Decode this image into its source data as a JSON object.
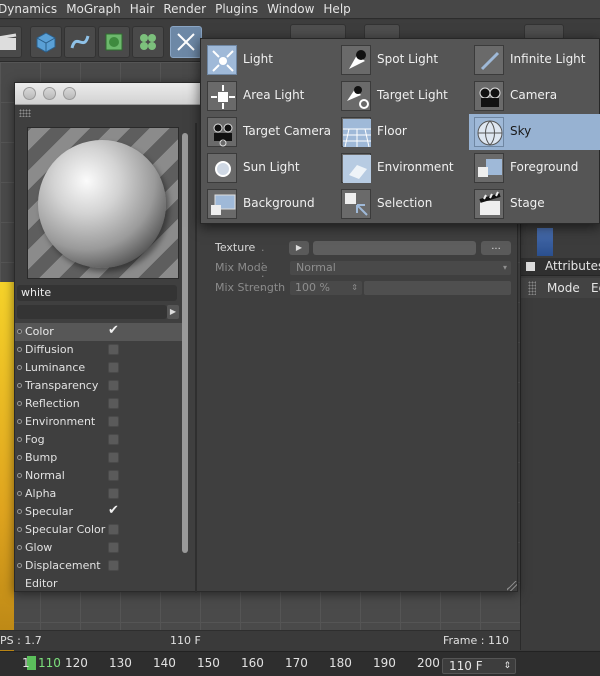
{
  "menubar": {
    "items": [
      "Dynamics",
      "MoGraph",
      "Hair",
      "Render",
      "Plugins",
      "Window",
      "Help"
    ]
  },
  "popup": {
    "items": [
      {
        "label": "Light",
        "icon": "light-icon"
      },
      {
        "label": "Area Light",
        "icon": "area-light-icon"
      },
      {
        "label": "Target Camera",
        "icon": "target-camera-icon"
      },
      {
        "label": "Sun Light",
        "icon": "sun-light-icon"
      },
      {
        "label": "Background",
        "icon": "background-icon"
      },
      {
        "label": "Spot Light",
        "icon": "spot-light-icon"
      },
      {
        "label": "Target Light",
        "icon": "target-light-icon"
      },
      {
        "label": "Floor",
        "icon": "floor-icon"
      },
      {
        "label": "Environment",
        "icon": "environment-icon"
      },
      {
        "label": "Selection",
        "icon": "selection-icon"
      },
      {
        "label": "Infinite Light",
        "icon": "infinite-light-icon"
      },
      {
        "label": "Camera",
        "icon": "camera-icon"
      },
      {
        "label": "Sky",
        "icon": "sky-icon"
      },
      {
        "label": "Foreground",
        "icon": "foreground-icon"
      },
      {
        "label": "Stage",
        "icon": "stage-icon"
      }
    ],
    "highlighted": "Sky"
  },
  "material": {
    "name": "white",
    "channels": [
      {
        "label": "Color",
        "checked": true,
        "selected": true
      },
      {
        "label": "Diffusion",
        "checked": false
      },
      {
        "label": "Luminance",
        "checked": false
      },
      {
        "label": "Transparency",
        "checked": false
      },
      {
        "label": "Reflection",
        "checked": false
      },
      {
        "label": "Environment",
        "checked": false
      },
      {
        "label": "Fog",
        "checked": false
      },
      {
        "label": "Bump",
        "checked": false
      },
      {
        "label": "Normal",
        "checked": false
      },
      {
        "label": "Alpha",
        "checked": false
      },
      {
        "label": "Specular",
        "checked": true
      },
      {
        "label": "Specular Color",
        "checked": false
      },
      {
        "label": "Glow",
        "checked": false
      },
      {
        "label": "Displacement",
        "checked": false
      },
      {
        "label": "Editor",
        "checked": null
      }
    ]
  },
  "texture": {
    "texture_label": "Texture",
    "more_label": "...",
    "mix_mode_label": "Mix Mode",
    "mix_mode_value": "Normal",
    "mix_strength_label": "Mix Strength",
    "mix_strength_value": "100 %"
  },
  "attributes": {
    "title": "Attributes",
    "mode_label": "Mode",
    "edit_label": "Ed"
  },
  "viewport_status": {
    "fps": "PS : 1.7",
    "frame_mid": "110 F",
    "frame_right": "Frame : 110"
  },
  "timeline": {
    "current": "110",
    "ticks": [
      "1",
      "120",
      "130",
      "140",
      "150",
      "160",
      "170",
      "180",
      "190",
      "200"
    ],
    "frame_field": "110 F"
  }
}
